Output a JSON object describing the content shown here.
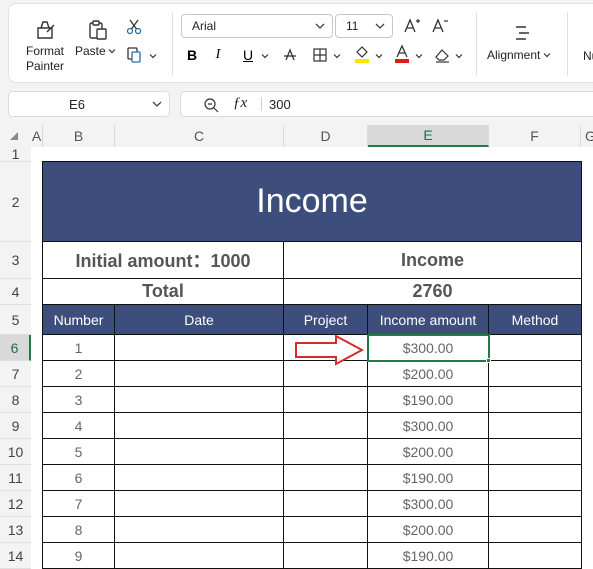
{
  "ribbon": {
    "format_painter_line1": "Format",
    "format_painter_line2": "Painter",
    "paste_label": "Paste",
    "font_name": "Arial",
    "font_size": "11",
    "bold_label": "B",
    "italic_label": "I",
    "underline_label": "U",
    "alignment_label": "Alignment",
    "number_partial": "Nu"
  },
  "formula_bar": {
    "name_box": "E6",
    "formula_value": "300"
  },
  "columns": [
    "A",
    "B",
    "C",
    "D",
    "E",
    "F",
    "G"
  ],
  "rows": [
    "1",
    "2",
    "3",
    "4",
    "5",
    "6",
    "7",
    "8",
    "9",
    "10",
    "11",
    "12",
    "13",
    "14"
  ],
  "sheet": {
    "title": "Income",
    "initial_amount_label": "Initial amount：1000",
    "income_label": "Income",
    "total_label": "Total",
    "total_value": "2760",
    "headers": {
      "number": "Number",
      "date": "Date",
      "project": "Project",
      "income_amount": "Income amount",
      "method": "Method"
    },
    "records": [
      {
        "number": "1",
        "date": "",
        "project": "",
        "amount": "$300.00",
        "method": ""
      },
      {
        "number": "2",
        "date": "",
        "project": "",
        "amount": "$200.00",
        "method": ""
      },
      {
        "number": "3",
        "date": "",
        "project": "",
        "amount": "$190.00",
        "method": ""
      },
      {
        "number": "4",
        "date": "",
        "project": "",
        "amount": "$300.00",
        "method": ""
      },
      {
        "number": "5",
        "date": "",
        "project": "",
        "amount": "$200.00",
        "method": ""
      },
      {
        "number": "6",
        "date": "",
        "project": "",
        "amount": "$190.00",
        "method": ""
      },
      {
        "number": "7",
        "date": "",
        "project": "",
        "amount": "$300.00",
        "method": ""
      },
      {
        "number": "8",
        "date": "",
        "project": "",
        "amount": "$200.00",
        "method": ""
      },
      {
        "number": "9",
        "date": "",
        "project": "",
        "amount": "$190.00",
        "method": ""
      }
    ]
  },
  "colors": {
    "header_navy": "#3d4d7c",
    "selection_green": "#1f7a45",
    "arrow_red": "#d62b2b",
    "highlight_yellow": "#f5e600",
    "font_color_red": "#e01b1b"
  },
  "icons": [
    "format-painter-icon",
    "paste-icon",
    "cut-icon",
    "copy-icon",
    "increase-font-icon",
    "decrease-font-icon",
    "strikethrough-icon",
    "borders-icon",
    "fill-color-icon",
    "font-color-icon",
    "clear-icon",
    "align-icon",
    "zoom-icon",
    "fx-icon",
    "red-arrow-annotation"
  ]
}
